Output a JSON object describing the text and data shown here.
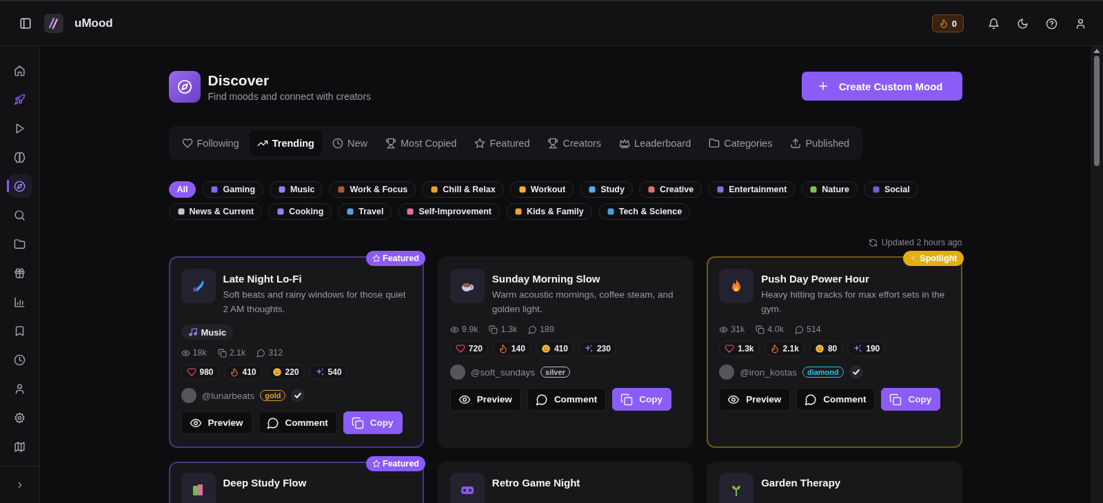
{
  "header": {
    "app_name": "uMood",
    "streak": "0"
  },
  "sidebar": {
    "items": [
      {
        "selected": false,
        "highlighted": false
      },
      {
        "selected": false,
        "highlighted": true
      },
      {
        "selected": false,
        "highlighted": false
      },
      {
        "selected": false,
        "highlighted": false
      },
      {
        "selected": true,
        "highlighted": false
      },
      {
        "selected": false,
        "highlighted": false
      },
      {
        "selected": false,
        "highlighted": false
      },
      {
        "selected": false,
        "highlighted": false
      },
      {
        "selected": false,
        "highlighted": false
      },
      {
        "selected": false,
        "highlighted": false
      },
      {
        "selected": false,
        "highlighted": false
      },
      {
        "selected": false,
        "highlighted": false
      },
      {
        "selected": false,
        "highlighted": false
      },
      {
        "selected": false,
        "highlighted": false
      }
    ]
  },
  "page": {
    "title": "Discover",
    "subtitle": "Find moods and connect with creators",
    "create_button": "Create Custom Mood"
  },
  "tabs": [
    {
      "label": "Following",
      "selected": false
    },
    {
      "label": "Trending",
      "selected": true
    },
    {
      "label": "New",
      "selected": false
    },
    {
      "label": "Most Copied",
      "selected": false
    },
    {
      "label": "Featured",
      "selected": false
    },
    {
      "label": "Creators",
      "selected": false
    },
    {
      "label": "Leaderboard",
      "selected": false
    },
    {
      "label": "Categories",
      "selected": false
    },
    {
      "label": "Published",
      "selected": false
    }
  ],
  "categories": [
    {
      "label": "All",
      "selected": true
    },
    {
      "label": "Gaming",
      "selected": false
    },
    {
      "label": "Music",
      "selected": false
    },
    {
      "label": "Work & Focus",
      "selected": false
    },
    {
      "label": "Chill & Relax",
      "selected": false
    },
    {
      "label": "Workout",
      "selected": false
    },
    {
      "label": "Study",
      "selected": false
    },
    {
      "label": "Creative",
      "selected": false
    },
    {
      "label": "Entertainment",
      "selected": false
    },
    {
      "label": "Nature",
      "selected": false
    },
    {
      "label": "Social",
      "selected": false
    },
    {
      "label": "News & Current",
      "selected": false
    },
    {
      "label": "Cooking",
      "selected": false
    },
    {
      "label": "Travel",
      "selected": false
    },
    {
      "label": "Self-Improvement",
      "selected": false
    },
    {
      "label": "Kids & Family",
      "selected": false
    },
    {
      "label": "Tech & Science",
      "selected": false
    }
  ],
  "updated": "Updated 2 hours ago",
  "moods": [
    {
      "ribbon": {
        "kind": "featured",
        "label": "Featured"
      },
      "title": "Late Night Lo-Fi",
      "description": "Soft beats and rainy windows for those quiet 2 AM thoughts.",
      "tag": "Music",
      "views": "18k",
      "copies": "2.1k",
      "comments": "312",
      "reactions": [
        {
          "kind": "heart",
          "count": "980"
        },
        {
          "kind": "fire",
          "count": "410"
        },
        {
          "kind": "smile",
          "count": "220"
        },
        {
          "kind": "sparkle",
          "count": "540"
        }
      ],
      "author": "@lunarbeats",
      "tier": {
        "label": "gold",
        "color": "#e0a030"
      },
      "verified": true,
      "actions": [
        {
          "label": "Preview",
          "primary": false
        },
        {
          "label": "Comment",
          "primary": false
        },
        {
          "label": "Copy",
          "primary": true
        }
      ]
    },
    {
      "title": "Sunday Morning Slow",
      "description": "Warm acoustic mornings, coffee steam, and golden light.",
      "views": "9.9k",
      "copies": "1.3k",
      "comments": "189",
      "reactions": [
        {
          "kind": "heart",
          "count": "720"
        },
        {
          "kind": "fire",
          "count": "140"
        },
        {
          "kind": "smile",
          "count": "410"
        },
        {
          "kind": "sparkle",
          "count": "230"
        }
      ],
      "author": "@soft_sundays",
      "tier": {
        "label": "silver",
        "color": "#b8bcc4"
      },
      "verified": false,
      "actions": [
        {
          "label": "Preview",
          "primary": false
        },
        {
          "label": "Comment",
          "primary": false
        },
        {
          "label": "Copy",
          "primary": true
        }
      ]
    },
    {
      "ribbon": {
        "kind": "spotlight",
        "label": "Spotlight"
      },
      "title": "Push Day Power Hour",
      "description": "Heavy hitting tracks for max effort sets in the gym.",
      "views": "31k",
      "copies": "4.0k",
      "comments": "514",
      "reactions": [
        {
          "kind": "heart",
          "count": "1.3k"
        },
        {
          "kind": "fire",
          "count": "2.1k"
        },
        {
          "kind": "smile",
          "count": "80"
        },
        {
          "kind": "sparkle",
          "count": "190"
        }
      ],
      "author": "@iron_kostas",
      "tier": {
        "label": "diamond",
        "color": "#22c3e6"
      },
      "verified": true,
      "actions": [
        {
          "label": "Preview",
          "primary": false
        },
        {
          "label": "Comment",
          "primary": false
        },
        {
          "label": "Copy",
          "primary": true
        }
      ]
    },
    {
      "ribbon": {
        "kind": "featured",
        "label": "Featured"
      },
      "title": "Deep Study Flow"
    },
    {
      "title": "Retro Game Night"
    },
    {
      "title": "Garden Therapy"
    }
  ]
}
